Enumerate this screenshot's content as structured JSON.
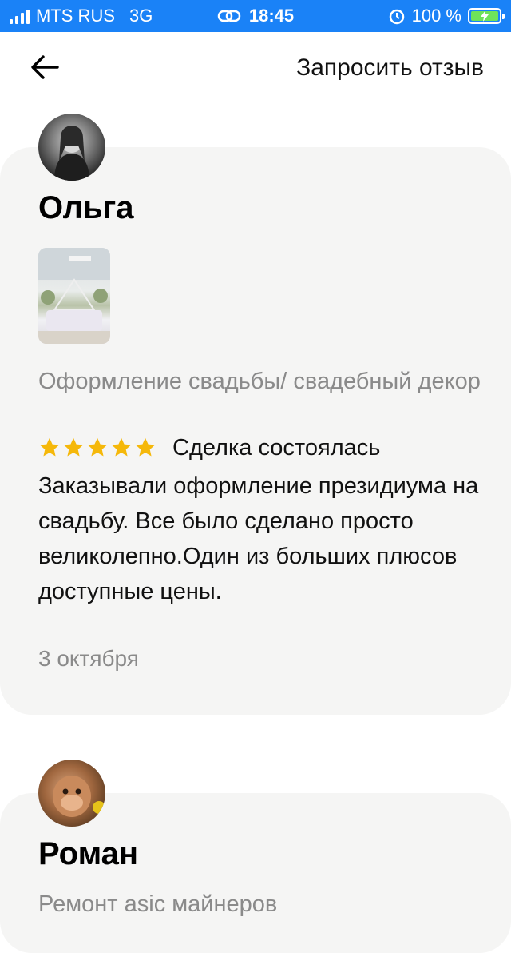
{
  "status_bar": {
    "carrier": "MTS RUS",
    "network": "3G",
    "time": "18:45",
    "battery": "100 %"
  },
  "header": {
    "request_review": "Запросить отзыв"
  },
  "reviews": [
    {
      "name": "Ольга",
      "category": "Оформление свадьбы/ свадебный декор",
      "rating": 5,
      "deal_status": "Сделка состоялась",
      "text": "Заказывали оформление президиума на свадьбу. Все было сделано просто великолепно.Один из больших плюсов доступные цены.",
      "date": "3 октября"
    },
    {
      "name": "Роман",
      "category": "Ремонт asic майнеров"
    }
  ],
  "colors": {
    "status_bar": "#1a82f7",
    "card_bg": "#f5f5f4",
    "star": "#f5b80a",
    "muted_text": "#8a8a8a"
  },
  "icons": {
    "back": "arrow-left-icon",
    "star": "star-icon"
  }
}
